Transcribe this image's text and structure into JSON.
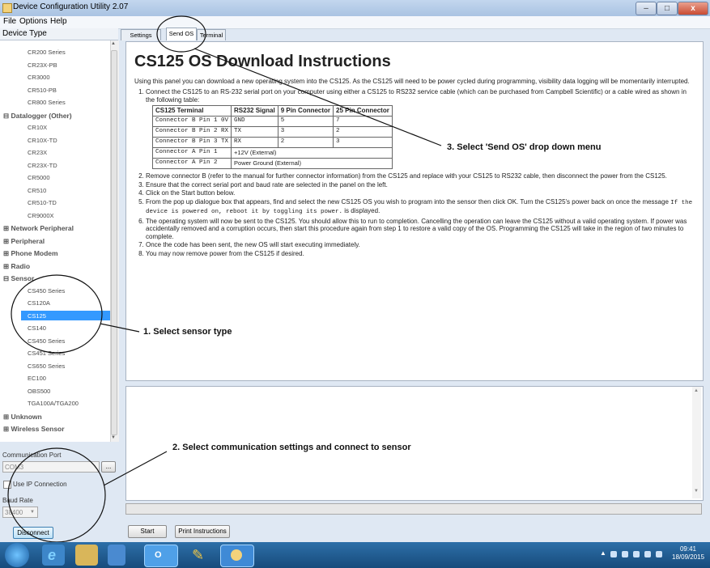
{
  "window": {
    "title": "Device Configuration Utility 2.07",
    "minimize": "–",
    "maximize": "□",
    "close": "x"
  },
  "menu": [
    "File",
    "Options",
    "Help"
  ],
  "left_panel": {
    "header": "Device Type",
    "items": [
      {
        "label": "CR200 Series",
        "kind": "item"
      },
      {
        "label": "CR23X-PB",
        "kind": "item"
      },
      {
        "label": "CR3000",
        "kind": "item"
      },
      {
        "label": "CR510-PB",
        "kind": "item"
      },
      {
        "label": "CR800 Series",
        "kind": "item"
      },
      {
        "label": "⊟ Datalogger (Other)",
        "kind": "category"
      },
      {
        "label": "CR10X",
        "kind": "item"
      },
      {
        "label": "CR10X-TD",
        "kind": "item"
      },
      {
        "label": "CR23X",
        "kind": "item"
      },
      {
        "label": "CR23X-TD",
        "kind": "item"
      },
      {
        "label": "CR5000",
        "kind": "item"
      },
      {
        "label": "CR510",
        "kind": "item"
      },
      {
        "label": "CR510-TD",
        "kind": "item"
      },
      {
        "label": "CR9000X",
        "kind": "item"
      },
      {
        "label": "⊞ Network Peripheral",
        "kind": "category"
      },
      {
        "label": "⊞ Peripheral",
        "kind": "category"
      },
      {
        "label": "⊞ Phone Modem",
        "kind": "category"
      },
      {
        "label": "⊞ Radio",
        "kind": "category"
      },
      {
        "label": "⊟ Sensor",
        "kind": "category"
      },
      {
        "label": "CS450 Series",
        "kind": "item"
      },
      {
        "label": "CS120A",
        "kind": "item"
      },
      {
        "label": "CS125",
        "kind": "selected"
      },
      {
        "label": "CS140",
        "kind": "item"
      },
      {
        "label": "CS450 Series",
        "kind": "item"
      },
      {
        "label": "CS451 Series",
        "kind": "item"
      },
      {
        "label": "CS650 Series",
        "kind": "item"
      },
      {
        "label": "EC100",
        "kind": "item"
      },
      {
        "label": "OBS500",
        "kind": "item"
      },
      {
        "label": "TGA100A/TGA200",
        "kind": "item"
      },
      {
        "label": "⊞ Unknown",
        "kind": "category"
      },
      {
        "label": "⊞ Wireless Sensor",
        "kind": "category"
      }
    ],
    "comm_port_label": "Communication Port",
    "comm_port_value": "COM3",
    "browse_button": "...",
    "use_ip_label": "Use IP Connection",
    "baud_rate_label": "Baud Rate",
    "baud_rate_value": "38400",
    "disconnect_button": "Disconnect"
  },
  "tabs": [
    {
      "label": "Settings Editor",
      "active": false
    },
    {
      "label": "Send OS",
      "active": true
    },
    {
      "label": "Terminal",
      "active": false
    }
  ],
  "doc": {
    "title": "CS125 OS Download Instructions",
    "intro": "Using this panel you can download a new operating system into the CS125. As the CS125 will need to be power cycled during programming, visibility data logging will be momentarily interrupted.",
    "step1": "Connect the CS125 to an RS-232 serial port on your computer using either a CS125 to RS232 service cable (which can be purchased from Campbell Scientific) or a cable wired as shown in the following table:",
    "table": {
      "headers": [
        "CS125 Terminal",
        "RS232 Signal",
        "9 Pin Connector",
        "25 Pin Connector"
      ],
      "rows": [
        [
          "Connector B Pin 1 0V",
          "GND",
          "5",
          "7"
        ],
        [
          "Connector B Pin 2 RX",
          "TX",
          "3",
          "2"
        ],
        [
          "Connector B Pin 3 TX",
          "RX",
          "2",
          "3"
        ],
        [
          "Connector A Pin 1",
          "+12V (External)"
        ],
        [
          "Connector A Pin 2",
          "Power Ground (External)"
        ]
      ]
    },
    "step2": "Remove connector B (refer to the manual for further connector information) from the CS125 and replace with your CS125 to RS232 cable, then disconnect the power from the CS125.",
    "step3": "Ensure that the correct serial port and baud rate are selected in the panel on the left.",
    "step4": "Click on the Start button below.",
    "step5a": "From the pop up dialogue box that appears, find and select the new CS125 OS you wish to program into the sensor then click OK. Turn the CS125's power back on once the message ",
    "step5b": "If the device is powered on, reboot it by toggling its power.",
    "step5c": " is displayed.",
    "step6": "The operating system will now be sent to the CS125. You should allow this to run to completion. Cancelling the operation can leave the CS125 without a valid operating system. If power was accidentally removed and a corruption occurs, then start this procedure again from step 1 to restore a valid copy of the OS. Programming the CS125 will take in the region of two minutes to complete.",
    "step7": "Once the code has been sent, the new OS will start executing immediately.",
    "step8": "You may now remove power from the CS125 if desired."
  },
  "bottom_buttons": {
    "start": "Start",
    "print": "Print Instructions"
  },
  "annotations": {
    "note1": "1. Select sensor type",
    "note2": "2. Select communication settings and connect to sensor",
    "note3": "3. Select 'Send OS' drop down menu"
  },
  "taskbar": {
    "time": "09:41",
    "date": "18/09/2015"
  }
}
